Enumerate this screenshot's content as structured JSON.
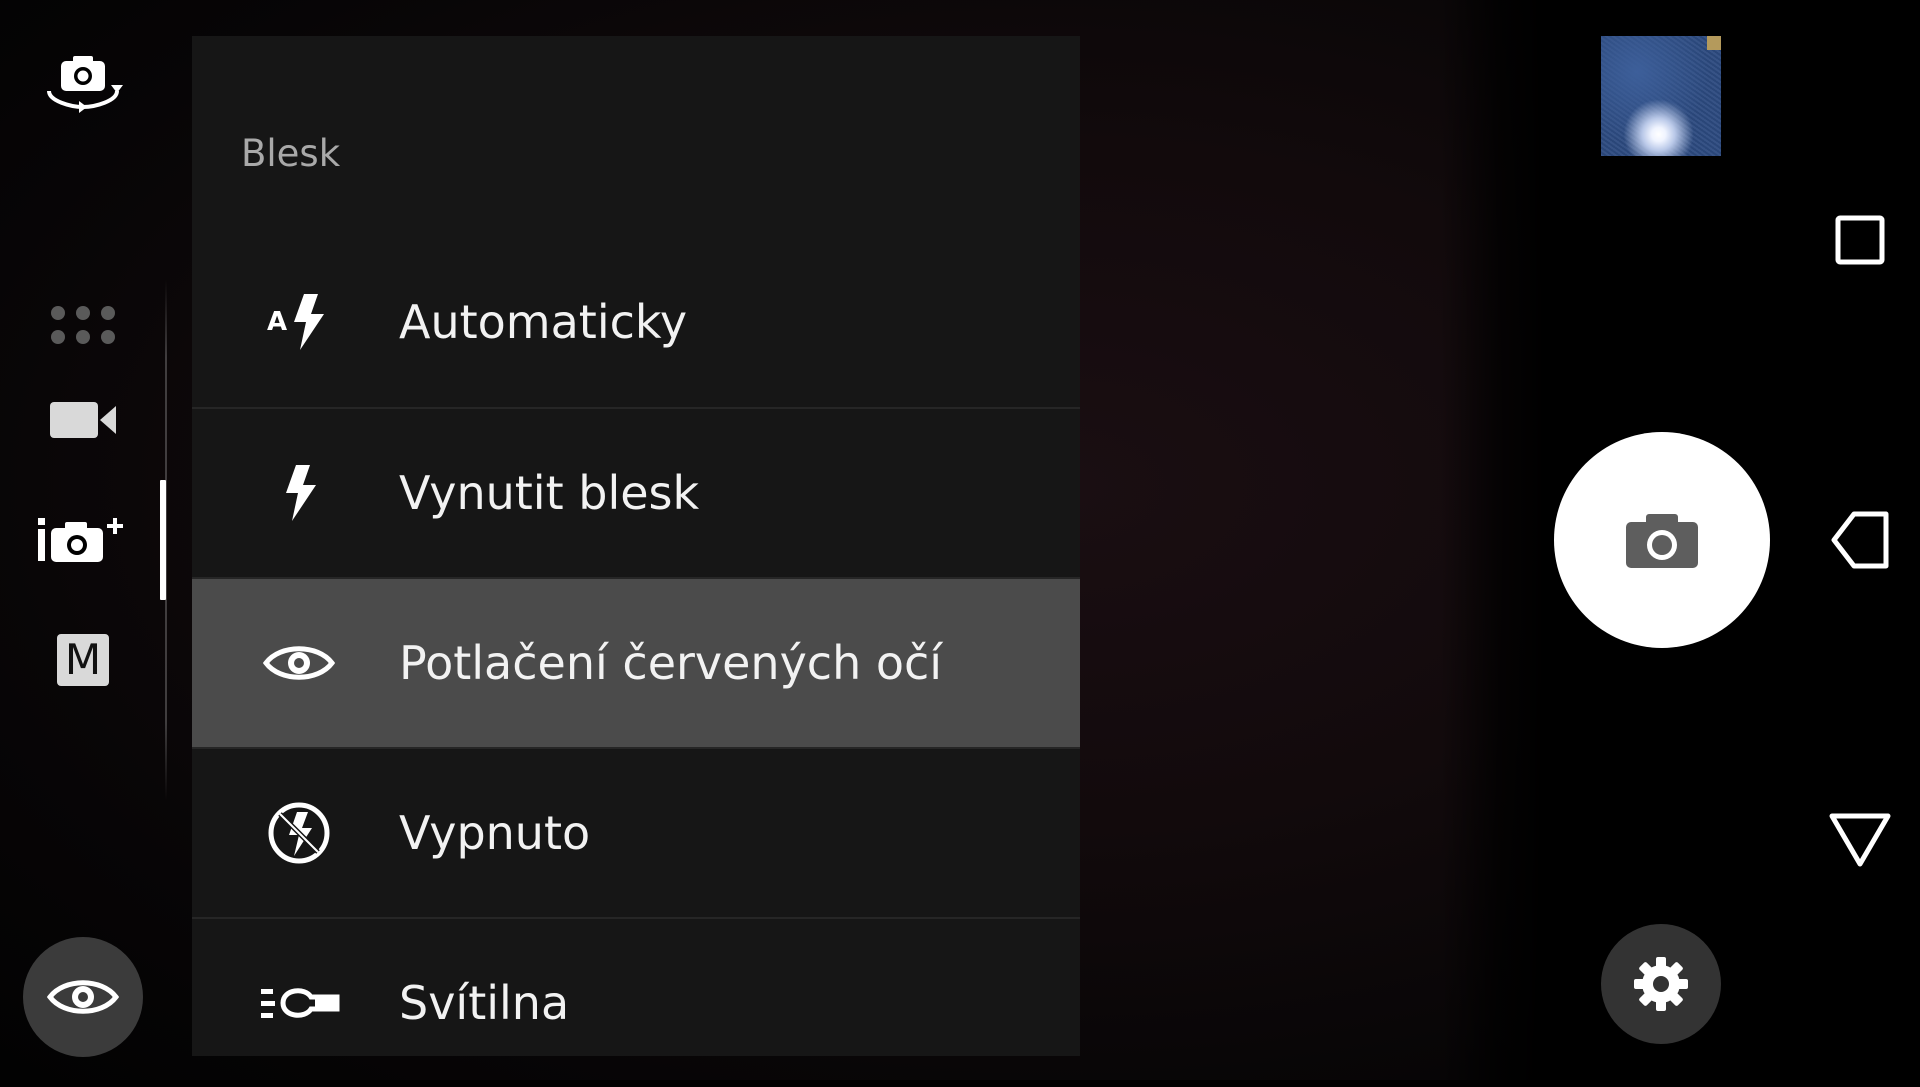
{
  "flash_menu": {
    "title": "Blesk",
    "items": [
      {
        "label": "Automaticky",
        "icon": "flash-auto-icon",
        "selected": false
      },
      {
        "label": "Vynutit blesk",
        "icon": "flash-on-icon",
        "selected": false
      },
      {
        "label": "Potlačení červených očí",
        "icon": "red-eye-icon",
        "selected": true
      },
      {
        "label": "Vypnuto",
        "icon": "flash-off-icon",
        "selected": false
      },
      {
        "label": "Svítilna",
        "icon": "torch-icon",
        "selected": false
      }
    ]
  },
  "left_rail": {
    "modes": [
      {
        "name": "switch-camera",
        "icon": "switch-camera-icon"
      },
      {
        "name": "camera-apps",
        "icon": "apps-grid-icon"
      },
      {
        "name": "video",
        "icon": "video-camera-icon"
      },
      {
        "name": "superior-auto",
        "icon": "superior-auto-icon",
        "active": true
      },
      {
        "name": "manual",
        "icon": "manual-mode-icon",
        "glyph": "M"
      }
    ],
    "flash_toggle_icon": "red-eye-icon"
  },
  "right_controls": {
    "shutter_icon": "camera-icon",
    "settings_icon": "gear-icon",
    "thumbnail": "gallery-thumbnail"
  },
  "nav_bar": {
    "buttons": [
      "recents-icon",
      "back-icon",
      "notification-shade-icon"
    ]
  },
  "colors": {
    "menu_background": "#161616",
    "menu_selected": "#4b4b4b",
    "menu_title": "#a9a9a9",
    "menu_text": "#f2f2f2",
    "shutter": "#ffffff",
    "settings_bg": "#333333"
  }
}
